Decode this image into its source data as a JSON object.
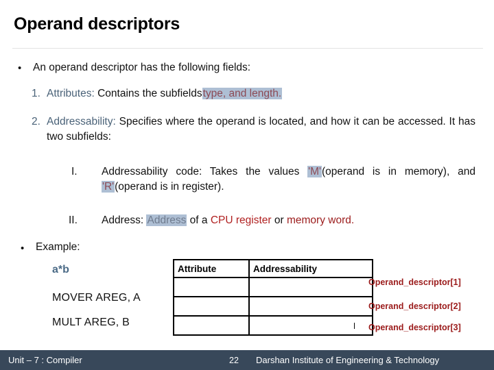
{
  "slide": {
    "title": "Operand descriptors",
    "page_number": "22"
  },
  "body": {
    "bullet_marker": "•",
    "intro": "An operand descriptor has the following fields:",
    "numbered": [
      {
        "marker": "1.",
        "keyword": "Attributes:",
        "text_before": "Contains the subfields",
        "highlight": "type, and length."
      },
      {
        "marker": "2.",
        "keyword": "Addressability:",
        "text": "Specifies where the operand is located, and how it can be accessed. It has two subfields:"
      }
    ],
    "sub_items": [
      {
        "marker": "I.",
        "seg1": "Addressability code: Takes the values",
        "hl1": "'M'",
        "seg2": "(operand is in memory), and",
        "hl2": "'R'",
        "seg3": "(operand is in register)."
      },
      {
        "marker": "II.",
        "seg1": "Address:",
        "hl1": "Address",
        "seg2": "of a",
        "red1": "CPU register",
        "seg3": "or",
        "red2": "memory word."
      }
    ],
    "example_label": "Example:",
    "example_expression": "a*b",
    "code_lines": [
      "MOVER AREG, A",
      "MULT AREG, B"
    ]
  },
  "table": {
    "headers": [
      "Attribute",
      "Addressability"
    ],
    "rows": [
      [
        "",
        ""
      ],
      [
        "",
        ""
      ],
      [
        "",
        ""
      ]
    ]
  },
  "side_labels": [
    "Operand_descriptor[1]",
    "Operand_descriptor[2]",
    "Operand_descriptor[3]"
  ],
  "footer": {
    "left": "Unit – 7 : Compiler",
    "right": "Darshan Institute of Engineering & Technology"
  },
  "colors": {
    "accent_slate": "#4a6278",
    "highlight_bg": "#aebfd4",
    "highlight_text": "#8c4a55",
    "red": "#b02020",
    "dark_red": "#9b1b1b",
    "footer_bg": "#38485a"
  }
}
